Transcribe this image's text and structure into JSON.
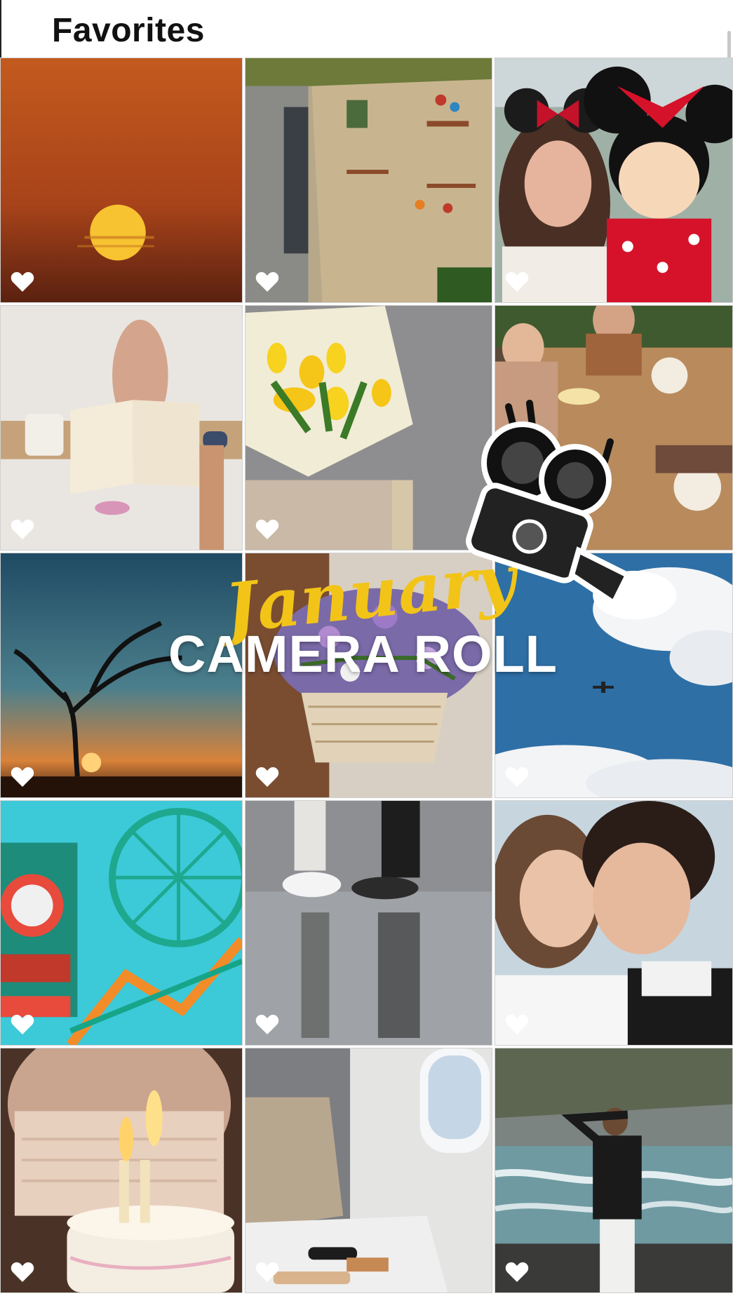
{
  "header": {
    "title": "Favorites"
  },
  "overlay": {
    "script_text": "January",
    "title_text": "CAMERA ROLL"
  },
  "colors": {
    "accent_yellow": "#f2c418",
    "heart": "#ffffff"
  },
  "photos": [
    {
      "id": "sunset-orange",
      "favorite": true
    },
    {
      "id": "decorated-wall",
      "favorite": true
    },
    {
      "id": "minnie-selfie",
      "favorite": true
    },
    {
      "id": "book-in-bath",
      "favorite": true
    },
    {
      "id": "yellow-tulips",
      "favorite": true
    },
    {
      "id": "dinner-toast",
      "favorite": true
    },
    {
      "id": "tree-sunset",
      "favorite": true
    },
    {
      "id": "flower-basket",
      "favorite": true
    },
    {
      "id": "sky-clouds-plane",
      "favorite": true
    },
    {
      "id": "wonder-wheel",
      "favorite": true
    },
    {
      "id": "sneakers-reflection",
      "favorite": true
    },
    {
      "id": "couple-hug",
      "favorite": true
    },
    {
      "id": "birthday-cake-16",
      "favorite": true
    },
    {
      "id": "airplane-seat",
      "favorite": true
    },
    {
      "id": "river-rocks",
      "favorite": true
    }
  ]
}
